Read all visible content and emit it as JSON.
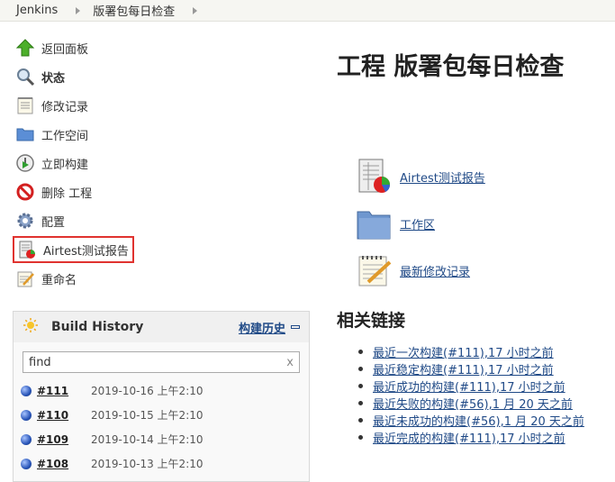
{
  "breadcrumb": {
    "root": "Jenkins",
    "project": "版署包每日检查"
  },
  "tasks": [
    {
      "label": "返回面板",
      "icon": "up-arrow-icon"
    },
    {
      "label": "状态",
      "icon": "magnifier-icon"
    },
    {
      "label": "修改记录",
      "icon": "notepad-icon"
    },
    {
      "label": "工作空间",
      "icon": "folder-icon"
    },
    {
      "label": "立即构建",
      "icon": "clock-play-icon"
    },
    {
      "label": "删除 工程",
      "icon": "no-entry-icon"
    },
    {
      "label": "配置",
      "icon": "gear-icon"
    },
    {
      "label": "Airtest测试报告",
      "icon": "report-icon"
    },
    {
      "label": "重命名",
      "icon": "notepad-pencil-icon"
    }
  ],
  "build_history": {
    "title": "Build History",
    "link": "构建历史",
    "search_value": "find",
    "clear": "x",
    "builds": [
      {
        "num": "#111",
        "date": "2019-10-16 上午2:10"
      },
      {
        "num": "#110",
        "date": "2019-10-15 上午2:10"
      },
      {
        "num": "#109",
        "date": "2019-10-14 上午2:10"
      },
      {
        "num": "#108",
        "date": "2019-10-13 上午2:10"
      }
    ]
  },
  "main": {
    "title": "工程 版署包每日检查",
    "links": [
      {
        "label": "Airtest测试报告",
        "icon": "report-icon"
      },
      {
        "label": "工作区",
        "icon": "folder-icon"
      },
      {
        "label": "最新修改记录",
        "icon": "notepad-pencil-icon"
      }
    ],
    "related_title": "相关链接",
    "related": [
      "最近一次构建(#111),17 小时之前",
      "最近稳定构建(#111),17 小时之前",
      "最近成功的构建(#111),17 小时之前",
      "最近失败的构建(#56),1 月 20 天之前",
      "最近未成功的构建(#56),1 月 20 天之前",
      "最近完成的构建(#111),17 小时之前"
    ]
  },
  "colors": {
    "link": "#204a87",
    "highlight_border": "#e0332f",
    "build_ball": "#2854b8"
  }
}
